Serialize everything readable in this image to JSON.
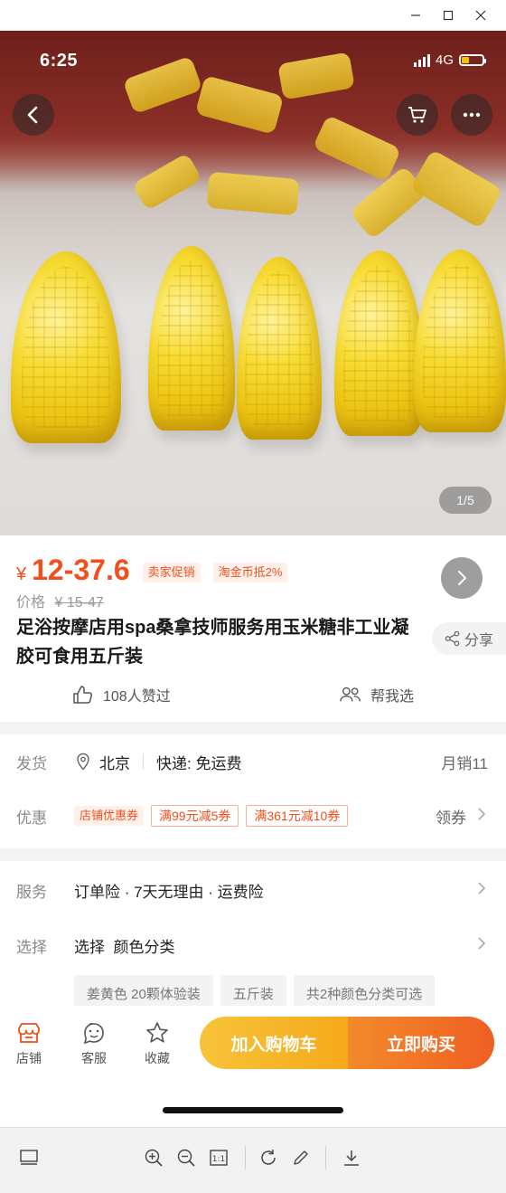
{
  "window": {
    "minimize_icon": "minimize-icon",
    "maximize_icon": "maximize-icon",
    "close_icon": "close-icon"
  },
  "status_bar": {
    "time": "6:25",
    "network": "4G",
    "battery_level": 0.35
  },
  "hero": {
    "counter": "1/5"
  },
  "price": {
    "symbol": "¥",
    "value": "12-37.6",
    "tags": [
      "卖家促销",
      "淘金币抵2%"
    ],
    "orig_label": "价格",
    "orig_value": "¥ 15-47"
  },
  "product": {
    "title": "足浴按摩店用spa桑拿技师服务用玉米糖非工业凝胶可食用五斤装",
    "share_label": "分享",
    "likes": "108人赞过",
    "help_choose": "帮我选"
  },
  "shipping": {
    "label": "发货",
    "location": "北京",
    "express": "快递: 免运费",
    "monthly_sales": "月销11"
  },
  "discount": {
    "label": "优惠",
    "shop_coupon": "店铺优惠券",
    "coupons": [
      "满99元减5券",
      "满361元减10券"
    ],
    "claim": "领券"
  },
  "service": {
    "label": "服务",
    "value": "订单险 · 7天无理由 · 运费险"
  },
  "select": {
    "label": "选择",
    "value": "选择  颜色分类",
    "chips": [
      "姜黄色 20颗体验装",
      "五斤装",
      "共2种颜色分类可选"
    ]
  },
  "bottom_bar": {
    "shop": "店铺",
    "service": "客服",
    "favorite": "收藏",
    "add_cart": "加入购物车",
    "buy_now": "立即购买"
  },
  "colors": {
    "accent": "#f04f1d",
    "cart_gradient": "#f6a91b",
    "buy_gradient": "#ef5f23"
  }
}
